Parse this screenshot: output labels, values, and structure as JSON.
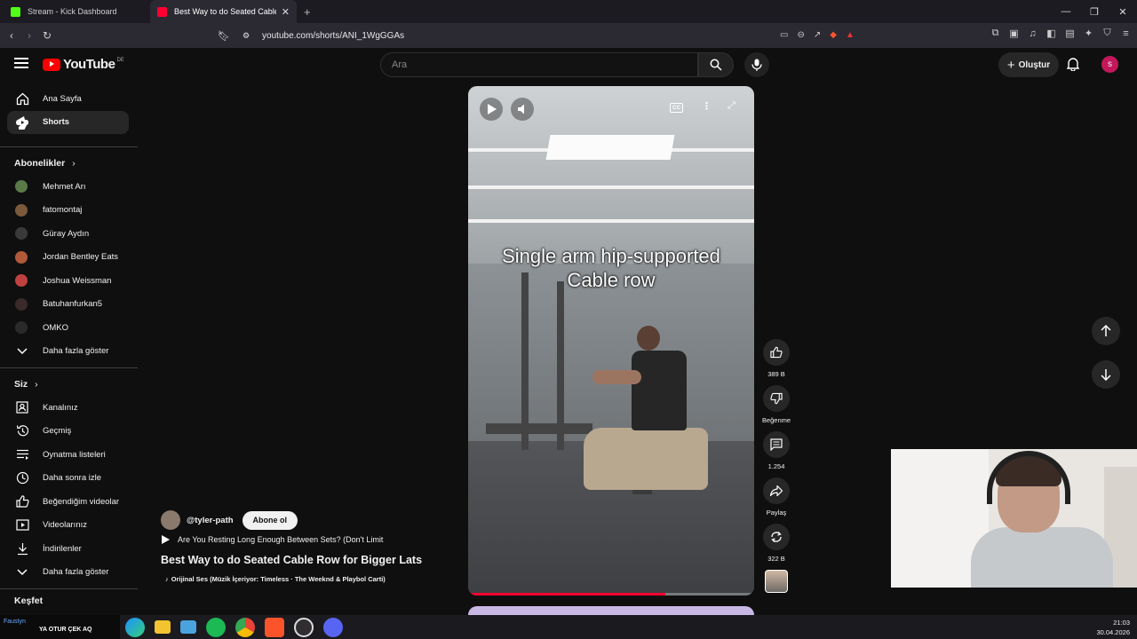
{
  "browser": {
    "tabs": [
      {
        "title": "Stream - Kick Dashboard",
        "favicon_color": "#53fc18",
        "active": false
      },
      {
        "title": "Best Way to do Seated Cable Ro",
        "favicon_color": "#ff0033",
        "active": true
      }
    ],
    "url": "youtube.com/shorts/ANI_1WgGGAs"
  },
  "header": {
    "logo_text": "YouTube",
    "country_code": "DE",
    "search_placeholder": "Ara",
    "create_label": "Oluştur",
    "avatar_letter": "S"
  },
  "sidebar": {
    "main": [
      {
        "label": "Ana Sayfa",
        "icon": "home-icon"
      },
      {
        "label": "Shorts",
        "icon": "shorts-icon",
        "active": true
      }
    ],
    "subscriptions_title": "Abonelikler",
    "subscriptions": [
      {
        "label": "Mehmet Arı",
        "color": "#5a7a4a"
      },
      {
        "label": "fatomontaj",
        "color": "#7a5a3a"
      },
      {
        "label": "Güray Aydın",
        "color": "#3a3a3a"
      },
      {
        "label": "Jordan Bentley Eats",
        "color": "#b05a3a"
      },
      {
        "label": "Joshua Weissman",
        "color": "#c04040"
      },
      {
        "label": "Batuhanfurkan5",
        "color": "#3a2a2a"
      },
      {
        "label": "OMKO",
        "color": "#2a2a2a"
      }
    ],
    "show_more_subs": "Daha fazla göster",
    "you_title": "Siz",
    "you_items": [
      {
        "label": "Kanalınız",
        "icon": "channel-icon"
      },
      {
        "label": "Geçmiş",
        "icon": "history-icon"
      },
      {
        "label": "Oynatma listeleri",
        "icon": "playlist-icon"
      },
      {
        "label": "Daha sonra izle",
        "icon": "watch-later-icon"
      },
      {
        "label": "Beğendiğim videolar",
        "icon": "like-icon"
      },
      {
        "label": "Videolarınız",
        "icon": "your-videos-icon"
      },
      {
        "label": "İndirilenler",
        "icon": "download-icon"
      }
    ],
    "show_more_you": "Daha fazla göster",
    "explore_title": "Keşfet"
  },
  "video": {
    "caption_line1": "Single arm hip-supported",
    "caption_line2": "Cable row",
    "progress": 0.69
  },
  "actions": [
    {
      "label": "389 B",
      "icon": "like-icon"
    },
    {
      "label": "Beğenme",
      "icon": "dislike-icon"
    },
    {
      "label": "1.254",
      "icon": "comment-icon"
    },
    {
      "label": "Paylaş",
      "icon": "share-icon"
    },
    {
      "label": "322 B",
      "icon": "remix-icon"
    }
  ],
  "channel": {
    "handle": "@tyler-path",
    "subscribe_label": "Abone ol",
    "related_video": "Are You Resting Long Enough Between Sets? (Don't Limit",
    "title": "Best Way to do Seated Cable Row for Bigger Lats",
    "audio": "Orijinal Ses (Müzik İçeriyor: Timeless · The Weeknd & Playbol Carti)"
  },
  "taskbar": {
    "overlay_line1": "Faustyn",
    "overlay_line2": "YA OTUR ÇEK AQ",
    "time": "21:03",
    "date": "30.04.2026"
  }
}
